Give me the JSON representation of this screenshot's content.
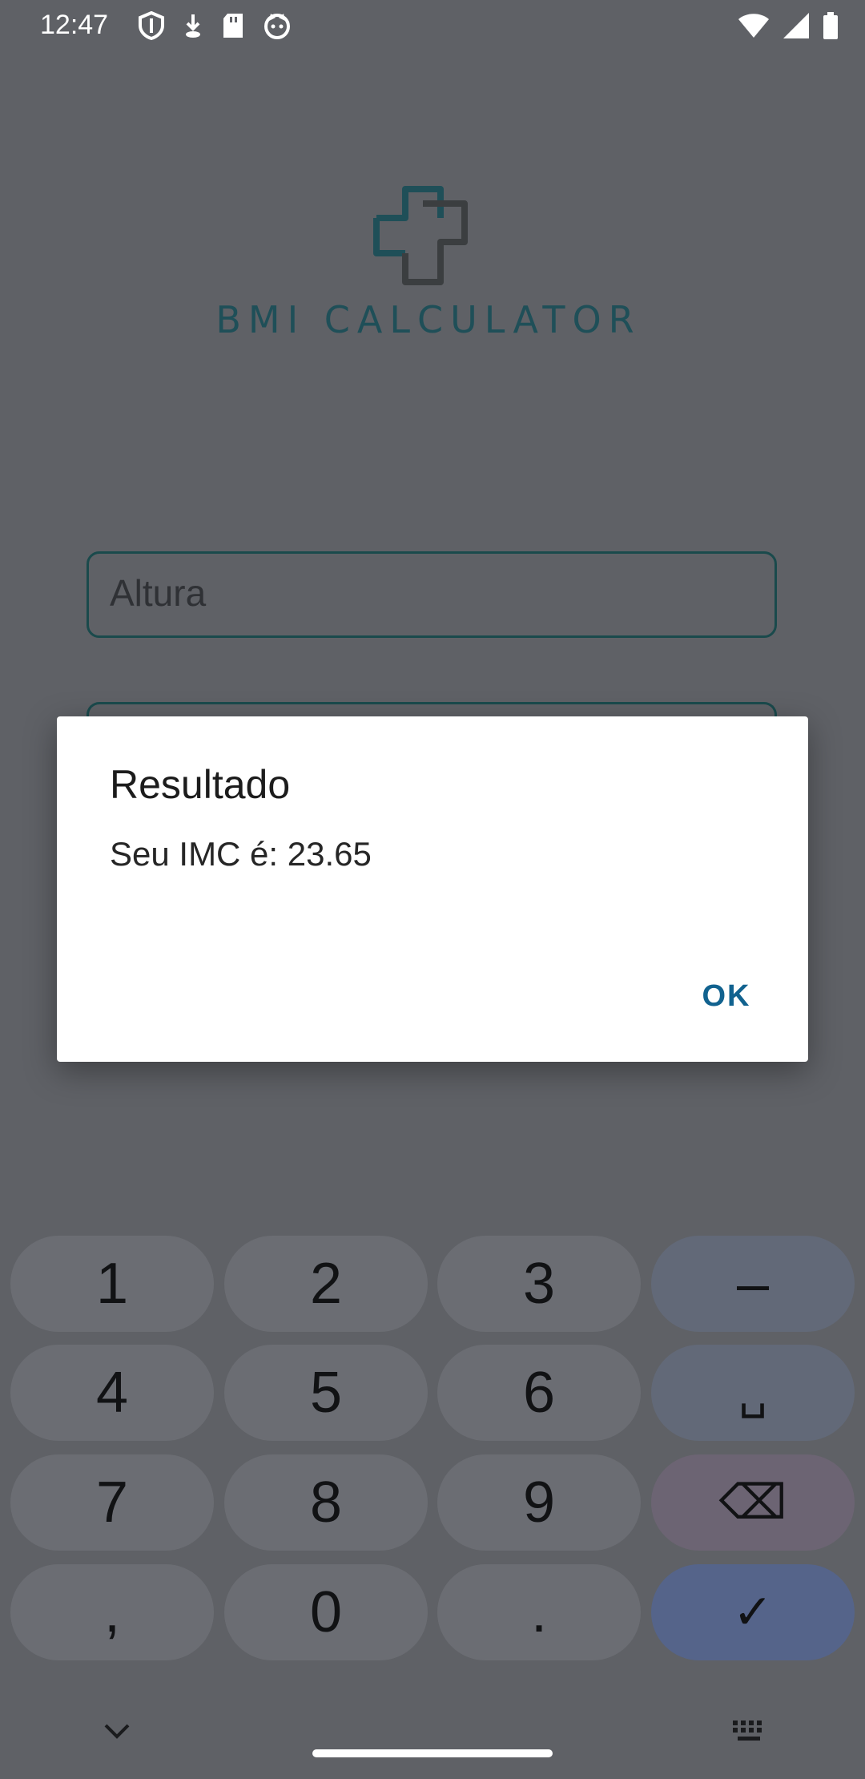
{
  "status_bar": {
    "time": "12:47"
  },
  "app": {
    "logo_title": "BMI CALCULATOR"
  },
  "form": {
    "height_placeholder": "Altura",
    "weight_placeholder": ""
  },
  "dialog": {
    "title": "Resultado",
    "message": "Seu IMC é: 23.65",
    "ok_label": "OK"
  },
  "keyboard": {
    "keys": [
      "1",
      "2",
      "3",
      "–",
      "4",
      "5",
      "6",
      "␣",
      "7",
      "8",
      "9",
      "⌫",
      ",",
      "0",
      ".",
      "✓"
    ]
  },
  "colors": {
    "accent": "#11628f",
    "logo": "#1f4f58",
    "scrim_background": "#5f6166",
    "enter_key": "#55648a"
  },
  "icons": {
    "status_left": [
      "shield-icon",
      "download-icon",
      "sd-card-icon",
      "cat-icon"
    ],
    "status_right": [
      "wifi-icon",
      "signal-icon",
      "battery-icon"
    ],
    "keyboard_bottom": [
      "chevron-down-icon",
      "keyboard-icon"
    ]
  }
}
